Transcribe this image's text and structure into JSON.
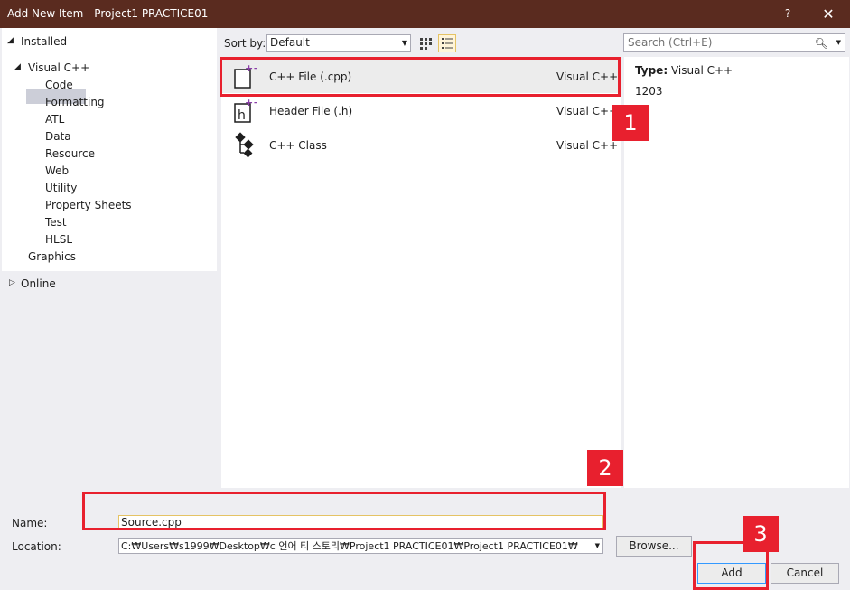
{
  "window": {
    "title": "Add New Item - Project1 PRACTICE01",
    "help_label": "?",
    "close_label": "✕"
  },
  "tree": {
    "installed_label": "Installed",
    "visual_cpp_label": "Visual C++",
    "children": [
      "Code",
      "Formatting",
      "ATL",
      "Data",
      "Resource",
      "Web",
      "Utility",
      "Property Sheets",
      "Test",
      "HLSL"
    ],
    "graphics_label": "Graphics",
    "online_label": "Online"
  },
  "toolbar": {
    "sort_label": "Sort by:",
    "sort_value": "Default",
    "search_placeholder": "Search (Ctrl+E)"
  },
  "items": [
    {
      "name": "C++ File (.cpp)",
      "lang": "Visual C++"
    },
    {
      "name": "Header File (.h)",
      "lang": "Visual C++"
    },
    {
      "name": "C++ Class",
      "lang": "Visual C++"
    }
  ],
  "details": {
    "type_label": "Type:",
    "type_value": "Visual C++",
    "id_value": "1203"
  },
  "form": {
    "name_label": "Name:",
    "name_value": "Source.cpp",
    "location_label": "Location:",
    "location_value": "C:₩Users₩s1999₩Desktop₩c 언어 티 스토리₩Project1 PRACTICE01₩Project1 PRACTICE01₩",
    "browse_label": "Browse...",
    "add_label": "Add",
    "cancel_label": "Cancel"
  },
  "annotations": {
    "step1": "1",
    "step2": "2",
    "step3": "3",
    "color": "#e8202e"
  }
}
